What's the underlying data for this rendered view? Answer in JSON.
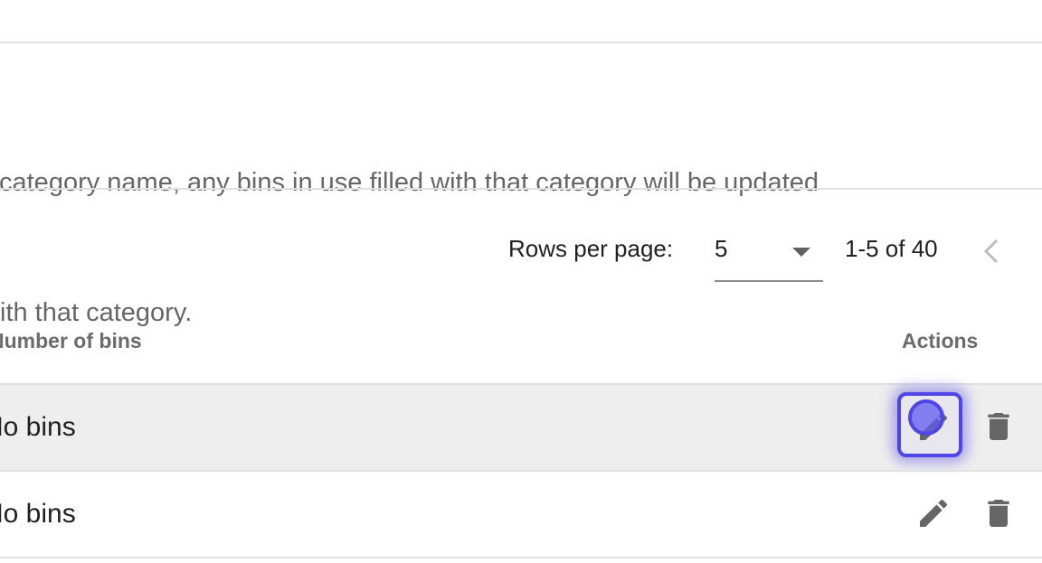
{
  "description": {
    "line1": "edit a category name, any bins in use filled with that category will be updated",
    "line2": "ith that category."
  },
  "pagination": {
    "rows_per_page_label": "Rows per page:",
    "rows_per_page_value": "5",
    "range_text": "1-5 of 40",
    "prev_icon": "chevron-left-icon"
  },
  "table": {
    "headers": {
      "bins": "Number of bins",
      "actions": "Actions"
    },
    "rows": [
      {
        "bins": "No bins",
        "hovered": true,
        "edit_focused": true
      },
      {
        "bins": "No bins",
        "hovered": false,
        "edit_focused": false
      }
    ],
    "icons": {
      "edit": "pencil-icon",
      "delete": "trash-icon"
    }
  },
  "colors": {
    "focus": "#4f46e5",
    "icon": "#666666",
    "hover_row": "#eeeeee"
  }
}
